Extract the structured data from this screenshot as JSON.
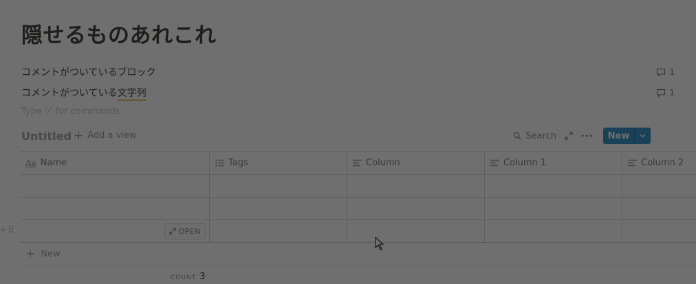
{
  "page": {
    "title": "隠せるものあれこれ",
    "blocks": [
      {
        "text": "コメントがついているブロック",
        "comments": "1"
      },
      {
        "text_plain": "コメントがついている",
        "text_highlight": "文字列",
        "comments": "1"
      }
    ],
    "placeholder": "Type '/' for commands"
  },
  "database": {
    "title": "Untitled",
    "add_view": "Add a view",
    "search_label": "Search",
    "new_label": "New",
    "columns": [
      {
        "label": "Name",
        "icon": "title-aa-icon"
      },
      {
        "label": "Tags",
        "icon": "multi-select-list-icon"
      },
      {
        "label": "Column",
        "icon": "text-lines-icon"
      },
      {
        "label": "Column 1",
        "icon": "text-lines-icon"
      },
      {
        "label": "Column 2",
        "icon": "text-lines-icon"
      }
    ],
    "rows": [
      "",
      "",
      ""
    ],
    "open_label": "OPEN",
    "new_row_label": "New",
    "count_label": "COUNT",
    "count_value": "3"
  },
  "colors": {
    "accent": "#2a8ec9",
    "highlight_underline": "#e2c35a",
    "overlay": "rgba(15,15,15,0.6)"
  }
}
